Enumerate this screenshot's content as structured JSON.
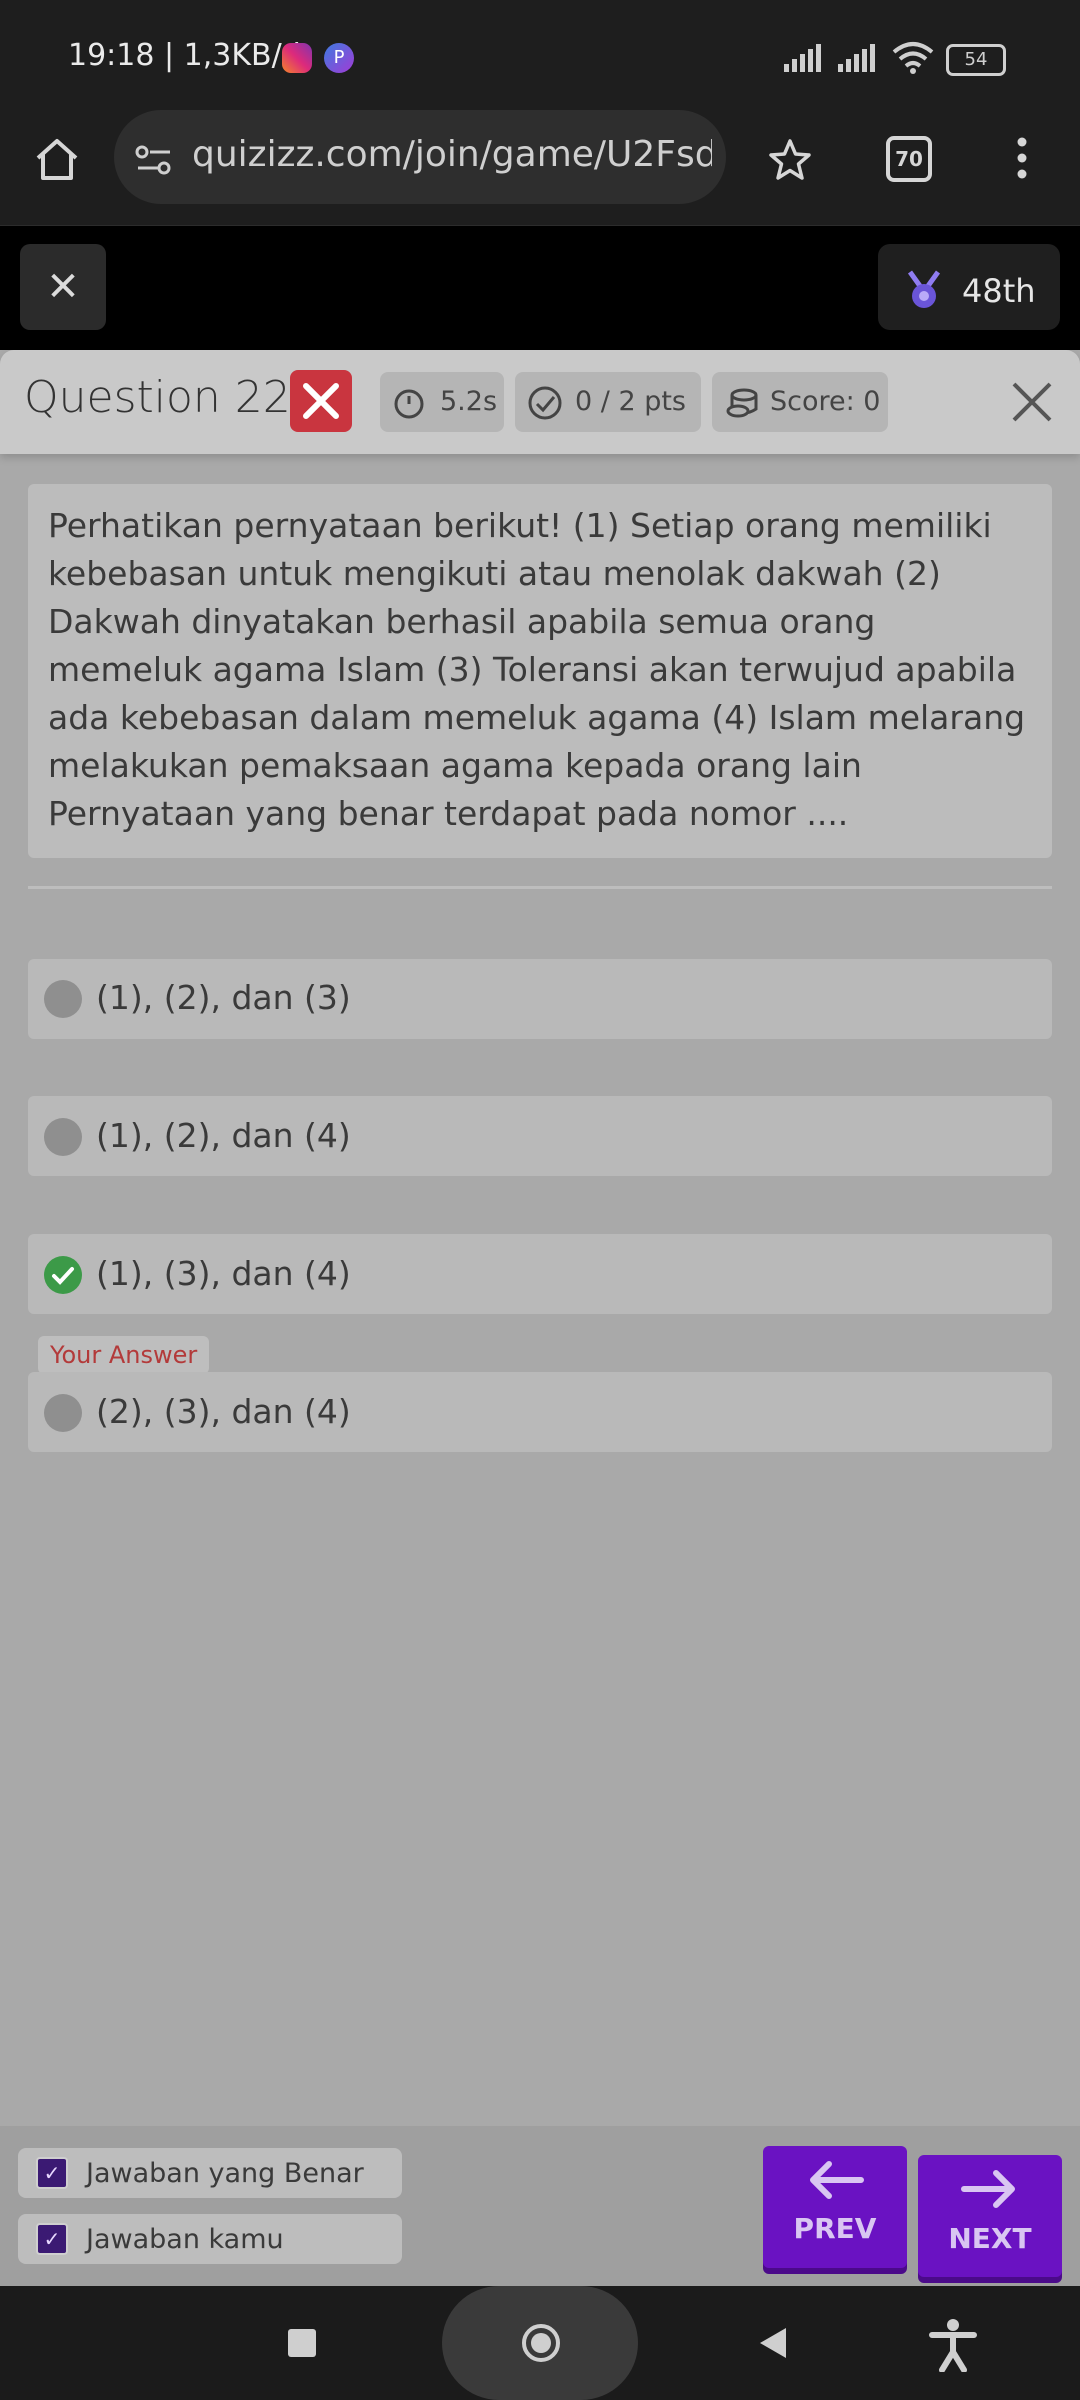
{
  "status_bar": {
    "time_speed": "19:18 | 1,3KB/d",
    "battery": "54"
  },
  "browser": {
    "url": "quizizz.com/join/game/U2Fsd",
    "tabs_count": "70"
  },
  "game": {
    "rank": "48th"
  },
  "review": {
    "title": "Question 22",
    "time": "5.2s",
    "points": "0 / 2 pts",
    "score": "Score: 0"
  },
  "question": {
    "text": "Perhatikan pernyataan berikut! (1) Setiap orang memiliki kebebasan untuk mengikuti atau menolak dakwah (2) Dakwah dinyatakan berhasil apabila semua orang memeluk agama Islam (3) Toleransi akan terwujud apabila ada kebebasan dalam memeluk agama (4) Islam melarang melakukan pemaksaan agama kepada orang lain Pernyataan yang benar terdapat pada nomor ...."
  },
  "options": [
    {
      "label": "(1), (2), dan (3)"
    },
    {
      "label": "(1), (2), dan (4)"
    },
    {
      "label": "(1), (3), dan (4)"
    },
    {
      "label": "(2), (3), dan (4)"
    }
  ],
  "your_answer_label": "Your Answer",
  "legend": {
    "correct": "Jawaban yang Benar",
    "yours": "Jawaban kamu"
  },
  "nav": {
    "prev": "PREV",
    "next": "NEXT"
  },
  "colors": {
    "accent": "#6a12c2",
    "correct": "#3c9a48",
    "wrong": "#c9353f"
  }
}
